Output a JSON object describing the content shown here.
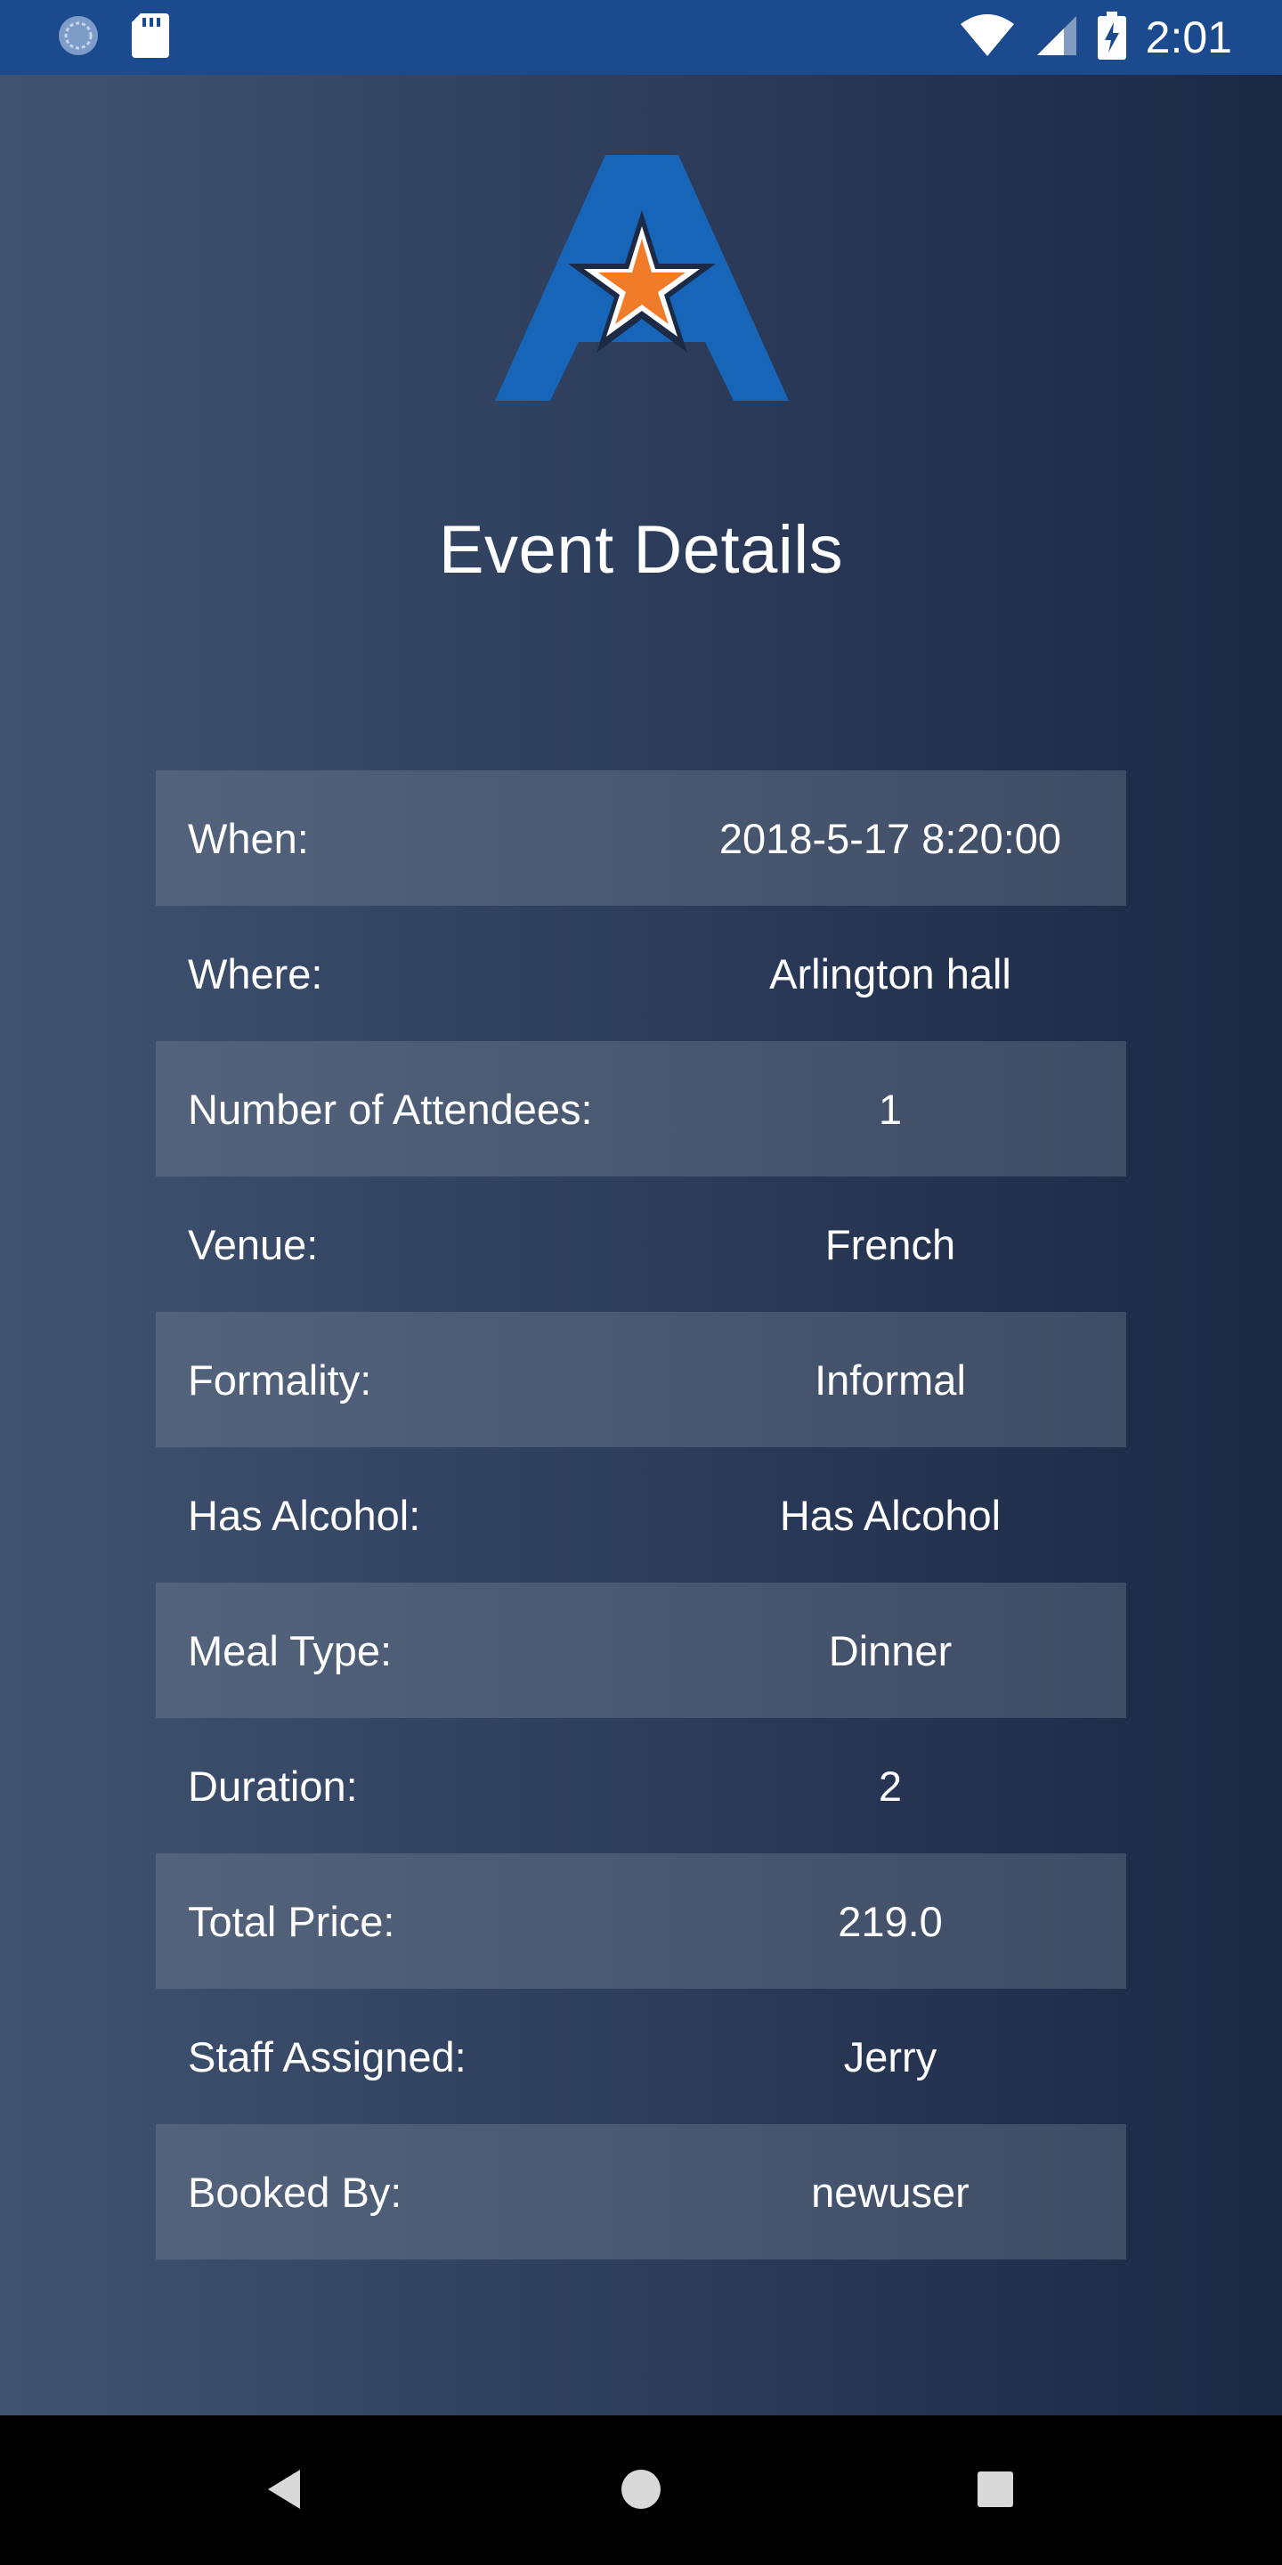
{
  "status_bar": {
    "time": "2:01",
    "icons": [
      "sync-icon",
      "sd-card-icon",
      "wifi-icon",
      "signal-icon",
      "battery-charging-icon"
    ]
  },
  "page": {
    "title": "Event Details",
    "logo_icon": "star-a-logo"
  },
  "details": [
    {
      "label": "When:",
      "value": "2018-5-17 8:20:00"
    },
    {
      "label": "Where:",
      "value": "Arlington hall"
    },
    {
      "label": "Number of Attendees:",
      "value": "1"
    },
    {
      "label": "Venue:",
      "value": "French"
    },
    {
      "label": "Formality:",
      "value": "Informal"
    },
    {
      "label": "Has Alcohol:",
      "value": "Has Alcohol"
    },
    {
      "label": "Meal Type:",
      "value": "Dinner"
    },
    {
      "label": "Duration:",
      "value": "2"
    },
    {
      "label": "Total Price:",
      "value": "219.0"
    },
    {
      "label": "Staff Assigned:",
      "value": "Jerry"
    },
    {
      "label": "Booked By:",
      "value": "newuser"
    }
  ],
  "nav_bar": {
    "buttons": [
      "back-icon",
      "home-icon",
      "recents-icon"
    ]
  },
  "colors": {
    "status_bar": "#1b4a8f",
    "logo_blue": "#1665b8",
    "logo_orange": "#f07c2a",
    "row_shade": "#4a5972"
  }
}
